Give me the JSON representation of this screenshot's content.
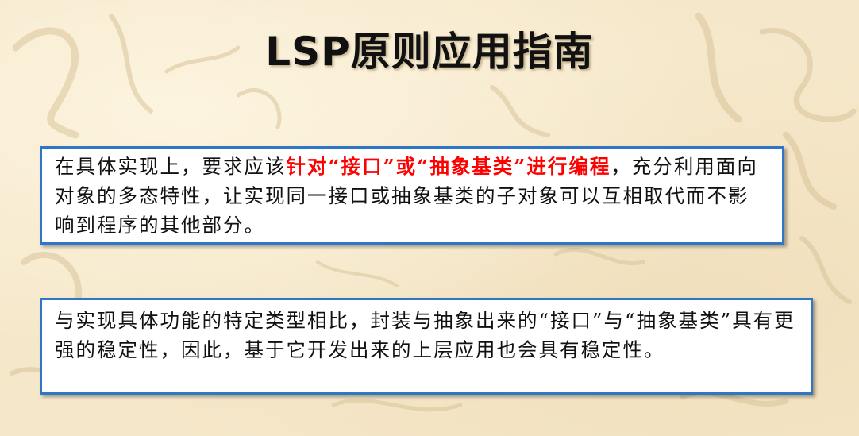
{
  "slide": {
    "title": "LSP原则应用指南",
    "background_color": "#f5e7c9",
    "calligraphy_color": "#d9c49a",
    "accent_border_color": "#2f77c6",
    "highlight_color": "#ff0000"
  },
  "box1": {
    "text_before": "在具体实现上，要求应该",
    "highlight": "针对“接口”或“抽象基类”进行编程",
    "text_after": "，充分利用面向对象的多态特性，让实现同一接口或抽象基类的子对象可以互相取代而不影响到程序的其他部分。"
  },
  "box2": {
    "text": "与实现具体功能的特定类型相比，封装与抽象出来的“接口”与“抽象基类”具有更强的稳定性，因此，基于它开发出来的上层应用也会具有稳定性。"
  }
}
